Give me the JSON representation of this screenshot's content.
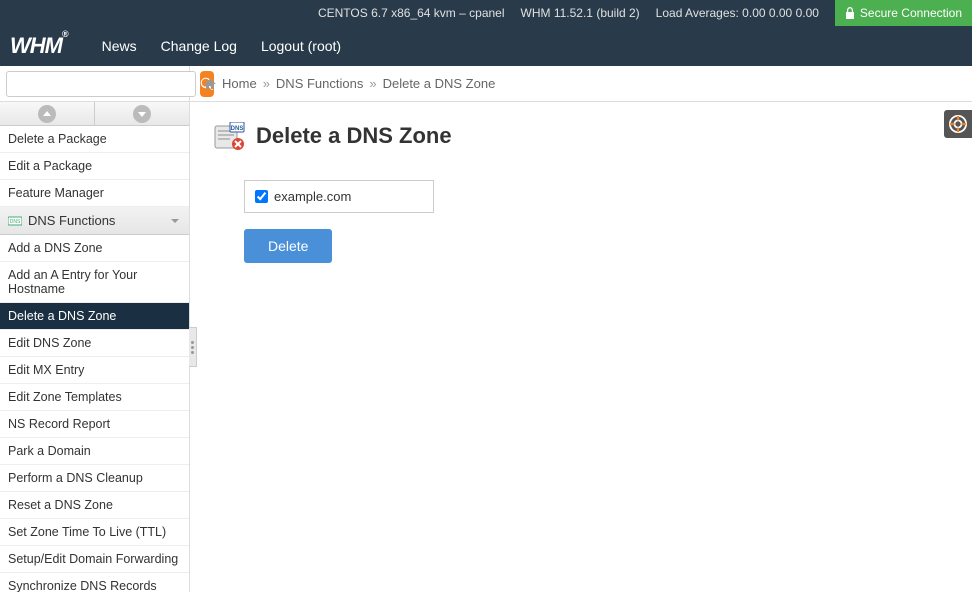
{
  "topbar": {
    "os": "CENTOS 6.7 x86_64 kvm – cpanel",
    "whm": "WHM 11.52.1 (build 2)",
    "load": "Load Averages: 0.00 0.00 0.00",
    "secure": "Secure Connection"
  },
  "nav": {
    "logo": "WHM",
    "news": "News",
    "changelog": "Change Log",
    "logout": "Logout (root)"
  },
  "search": {
    "placeholder": ""
  },
  "breadcrumb": {
    "home": "Home",
    "dns": "DNS Functions",
    "current": "Delete a DNS Zone"
  },
  "sidebar": {
    "group_label": "DNS Functions",
    "pre": [
      "Delete a Package",
      "Edit a Package",
      "Feature Manager"
    ],
    "items": [
      "Add a DNS Zone",
      "Add an A Entry for Your Hostname",
      "Delete a DNS Zone",
      "Edit DNS Zone",
      "Edit MX Entry",
      "Edit Zone Templates",
      "NS Record Report",
      "Park a Domain",
      "Perform a DNS Cleanup",
      "Reset a DNS Zone",
      "Set Zone Time To Live (TTL)",
      "Setup/Edit Domain Forwarding",
      "Synchronize DNS Records"
    ],
    "active": "Delete a DNS Zone"
  },
  "page": {
    "title": "Delete a DNS Zone",
    "zone": "example.com",
    "delete_label": "Delete"
  }
}
